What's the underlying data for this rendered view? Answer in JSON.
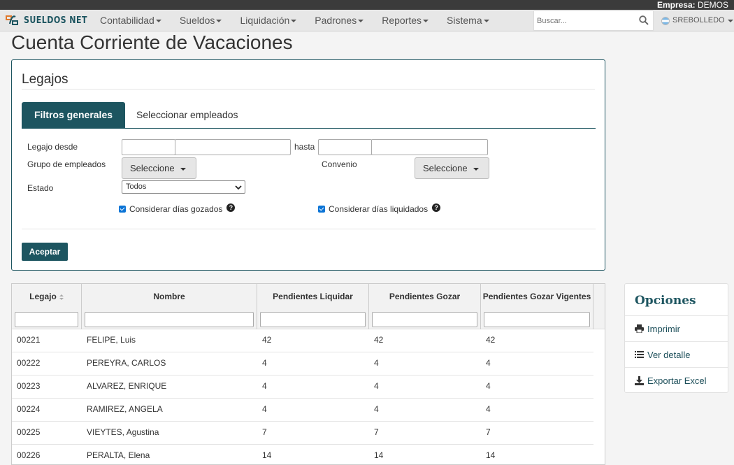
{
  "topbar": {
    "empresa_label": "Empresa:",
    "empresa_value": "DEMOS"
  },
  "brand": {
    "name": "SUELDOS NET"
  },
  "menu": [
    {
      "label": "Contabilidad"
    },
    {
      "label": "Sueldos"
    },
    {
      "label": "Liquidación"
    },
    {
      "label": "Padrones"
    },
    {
      "label": "Reportes"
    },
    {
      "label": "Sistema"
    }
  ],
  "search": {
    "placeholder": "Buscar..."
  },
  "user": {
    "name": "SREBOLLEDO"
  },
  "page": {
    "title": "Cuenta Corriente de Vacaciones"
  },
  "legajos": {
    "title": "Legajos",
    "tabs": [
      "Filtros generales",
      "Seleccionar empleados"
    ],
    "legajo_desde_label": "Legajo desde",
    "hasta_label": "hasta",
    "grupo_label": "Grupo de empleados",
    "grupo_value": "Seleccione",
    "convenio_label": "Convenio",
    "convenio_value": "Seleccione",
    "estado_label": "Estado",
    "estado_value": "Todos",
    "chk_gozados": "Considerar días gozados",
    "chk_liquidados": "Considerar días liquidados",
    "aceptar": "Aceptar"
  },
  "table": {
    "columns": [
      "Legajo",
      "Nombre",
      "Pendientes Liquidar",
      "Pendientes Gozar",
      "Pendientes Gozar Vigentes"
    ],
    "rows": [
      [
        "00221",
        "FELIPE, Luis",
        "42",
        "42",
        "42"
      ],
      [
        "00222",
        "PEREYRA, CARLOS",
        "4",
        "4",
        "4"
      ],
      [
        "00223",
        "ALVAREZ, ENRIQUE",
        "4",
        "4",
        "4"
      ],
      [
        "00224",
        "RAMIREZ, ANGELA",
        "4",
        "4",
        "4"
      ],
      [
        "00225",
        "VIEYTES, Agustina",
        "7",
        "7",
        "7"
      ],
      [
        "00226",
        "PERALTA, Elena",
        "14",
        "14",
        "14"
      ]
    ]
  },
  "opciones": {
    "title": "Opciones",
    "items": [
      {
        "label": "Imprimir",
        "icon": "print-icon"
      },
      {
        "label": "Ver detalle",
        "icon": "list-icon"
      },
      {
        "label": "Exportar Excel",
        "icon": "download-icon"
      }
    ]
  },
  "colors": {
    "accent": "#1d5560",
    "checkbox": "#0b74d6",
    "topbar": "#3b3b3b"
  }
}
